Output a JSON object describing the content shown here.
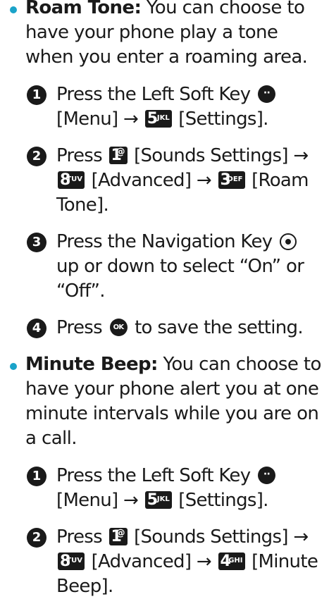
{
  "roam_tone": {
    "term": "Roam Tone:",
    "desc": " You can choose to have your phone play a tone when you enter a roaming area.",
    "steps": [
      {
        "num": "1",
        "t1": "Press the Left Soft Key ",
        "t2": " [Menu] → ",
        "k1": "5",
        "k1l": "JKL",
        "t3": " [Settings]."
      },
      {
        "num": "2",
        "t1": "Press ",
        "k1": "1",
        "k1l": "@",
        "t2": " [Sounds Settings] → ",
        "k2": "8",
        "k2l": "TUV",
        "t3": " [Advanced] → ",
        "k3": "3",
        "k3l": "DEF",
        "t4": " [Roam Tone]."
      },
      {
        "num": "3",
        "t1": "Press the Navigation Key ",
        "t2": " up or down to select “On” or “Off”."
      },
      {
        "num": "4",
        "t1": "Press ",
        "t2": " to save the setting."
      }
    ]
  },
  "minute_beep": {
    "term": "Minute Beep:",
    "desc": " You can choose to have your phone alert you at one minute intervals while you are on a call.",
    "steps": [
      {
        "num": "1",
        "t1": "Press the Left Soft Key ",
        "t2": " [Menu] → ",
        "k1": "5",
        "k1l": "JKL",
        "t3": " [Settings]."
      },
      {
        "num": "2",
        "t1": "Press ",
        "k1": "1",
        "k1l": "@",
        "t2": " [Sounds Settings] → ",
        "k2": "8",
        "k2l": "TUV",
        "t3": " [Advanced] → ",
        "k3": "4",
        "k3l": "GHI",
        "t4": " [Minute Beep]."
      }
    ]
  },
  "colors": {
    "bullet": "#1aa3c9",
    "text": "#1a1a1a"
  }
}
